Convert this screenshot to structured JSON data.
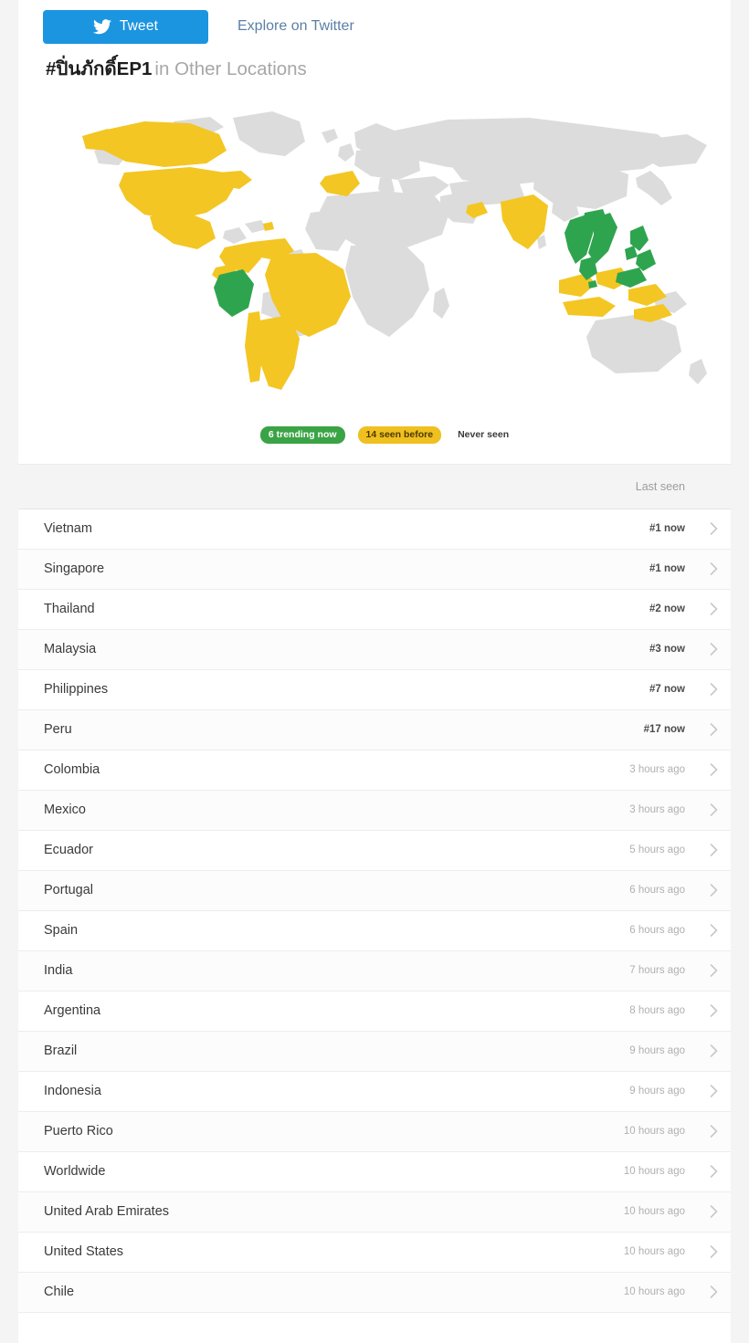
{
  "toolbar": {
    "tweet_label": "Tweet",
    "explore_label": "Explore on Twitter",
    "tweet_button_color": "#1b95e0",
    "explore_link_color": "#5b7fa6"
  },
  "header": {
    "hashtag": "#ปิ่นภักดิ์EP1",
    "subtitle": "in Other Locations"
  },
  "legend": {
    "trending_now": "6 trending now",
    "seen_before": "14 seen before",
    "never_seen": "Never seen",
    "trending_color": "#3aa346",
    "seen_color": "#f0c020",
    "never_color": "#d9d9d9"
  },
  "map": {
    "land_color": "#dcdcdc",
    "trending_color": "#2fa44f",
    "seen_color": "#f3c623",
    "ocean_color": "#ffffff"
  },
  "table": {
    "column_header_location": "",
    "column_header_lastseen": "Last seen",
    "rows": [
      {
        "location": "Vietnam",
        "last_seen": "#1 now",
        "state": "now"
      },
      {
        "location": "Singapore",
        "last_seen": "#1 now",
        "state": "now"
      },
      {
        "location": "Thailand",
        "last_seen": "#2 now",
        "state": "now"
      },
      {
        "location": "Malaysia",
        "last_seen": "#3 now",
        "state": "now"
      },
      {
        "location": "Philippines",
        "last_seen": "#7 now",
        "state": "now"
      },
      {
        "location": "Peru",
        "last_seen": "#17 now",
        "state": "now"
      },
      {
        "location": "Colombia",
        "last_seen": "3 hours ago",
        "state": "ago"
      },
      {
        "location": "Mexico",
        "last_seen": "3 hours ago",
        "state": "ago"
      },
      {
        "location": "Ecuador",
        "last_seen": "5 hours ago",
        "state": "ago"
      },
      {
        "location": "Portugal",
        "last_seen": "6 hours ago",
        "state": "ago"
      },
      {
        "location": "Spain",
        "last_seen": "6 hours ago",
        "state": "ago"
      },
      {
        "location": "India",
        "last_seen": "7 hours ago",
        "state": "ago"
      },
      {
        "location": "Argentina",
        "last_seen": "8 hours ago",
        "state": "ago"
      },
      {
        "location": "Brazil",
        "last_seen": "9 hours ago",
        "state": "ago"
      },
      {
        "location": "Indonesia",
        "last_seen": "9 hours ago",
        "state": "ago"
      },
      {
        "location": "Puerto Rico",
        "last_seen": "10 hours ago",
        "state": "ago"
      },
      {
        "location": "Worldwide",
        "last_seen": "10 hours ago",
        "state": "ago"
      },
      {
        "location": "United Arab Emirates",
        "last_seen": "10 hours ago",
        "state": "ago"
      },
      {
        "location": "United States",
        "last_seen": "10 hours ago",
        "state": "ago"
      },
      {
        "location": "Chile",
        "last_seen": "10 hours ago",
        "state": "ago"
      }
    ]
  },
  "icons": {
    "tweet": "twitter-bird-icon",
    "row_arrow": "chevron-right-icon"
  }
}
